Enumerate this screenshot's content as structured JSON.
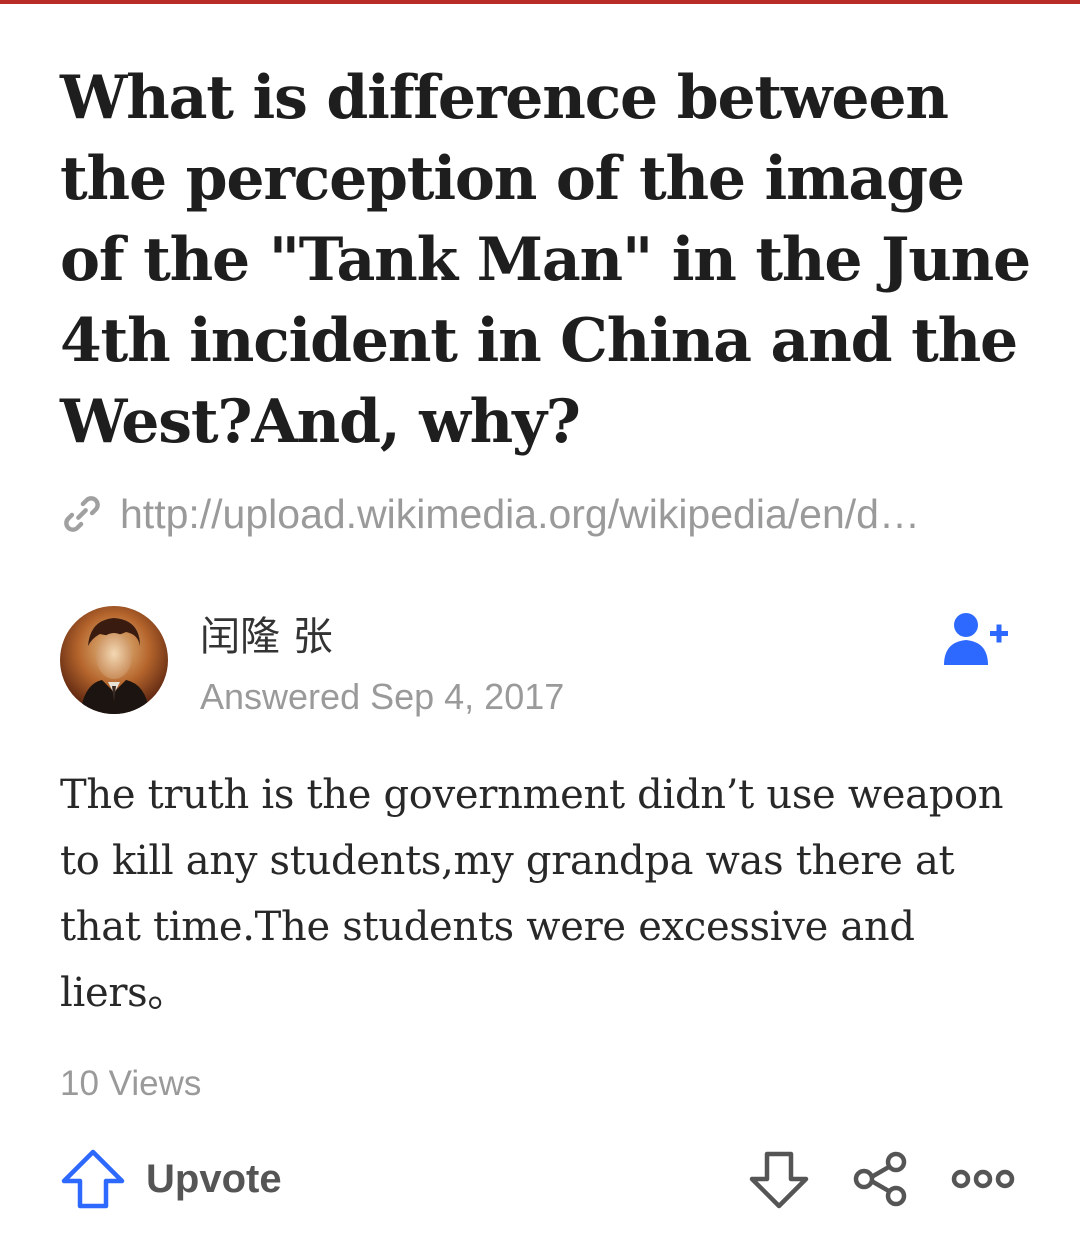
{
  "question": {
    "title": "What is difference between the perception of the image of the \"Tank Man\" in the June 4th incident in China and the West?And, why?",
    "link": "http://upload.wikimedia.org/wikipedia/en/d…"
  },
  "answer": {
    "author_name": "闰隆 张",
    "date": "Answered Sep 4, 2017",
    "body": "The truth is the government didn’t use weapon to kill any students,my grandpa was there at that time.The students were excessive and liers。",
    "views": "10 Views"
  },
  "actions": {
    "upvote_label": "Upvote"
  },
  "icons": {
    "link": "link-icon",
    "follow": "add-user-icon",
    "upvote": "arrow-up-icon",
    "downvote": "arrow-down-icon",
    "share": "share-icon",
    "more": "more-icon"
  },
  "colors": {
    "brand_bar": "#b92b27",
    "follow_blue": "#2e69ff",
    "upvote_blue": "#2e69ff",
    "muted_text": "#9a9a9a"
  }
}
